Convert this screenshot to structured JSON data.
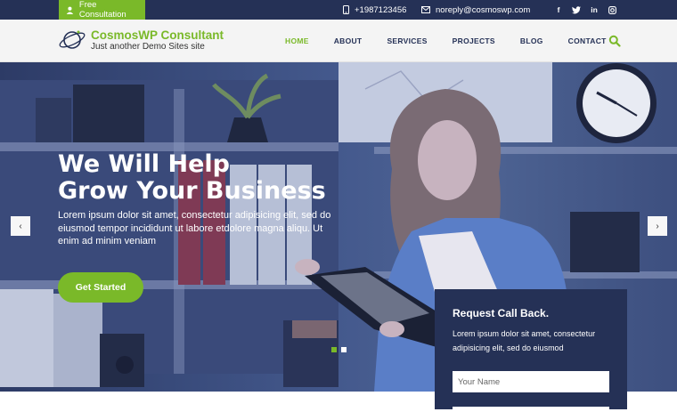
{
  "topbar": {
    "consultation_label": "Free Consultation",
    "phone": "+1987123456",
    "email": "noreply@cosmoswp.com",
    "socials": [
      "facebook-icon",
      "twitter-icon",
      "linkedin-icon",
      "instagram-icon"
    ]
  },
  "header": {
    "brand": "CosmosWP Consultant",
    "tagline": "Just another Demo Sites site",
    "nav": [
      "HOME",
      "ABOUT",
      "SERVICES",
      "PROJECTS",
      "BLOG",
      "CONTACT"
    ],
    "active_nav": "HOME"
  },
  "hero": {
    "title_line1": "We Will Help",
    "title_line2": "Grow Your Business",
    "text": "Lorem ipsum dolor sit amet, consectetur adipisicing elit, sed do eiusmod tempor incididunt ut labore etdolore magna aliqu. Ut enim ad minim veniam",
    "cta": "Get Started",
    "prev_arrow": "‹",
    "next_arrow": "›",
    "slide_count": 2,
    "active_slide": 1
  },
  "callback": {
    "title": "Request Call Back.",
    "text": "Lorem ipsum dolor sit amet, consectetur adipisicing elit, sed do eiusmod",
    "name_placeholder": "Your Name"
  },
  "colors": {
    "navy": "#253156",
    "green": "#7ab929"
  }
}
